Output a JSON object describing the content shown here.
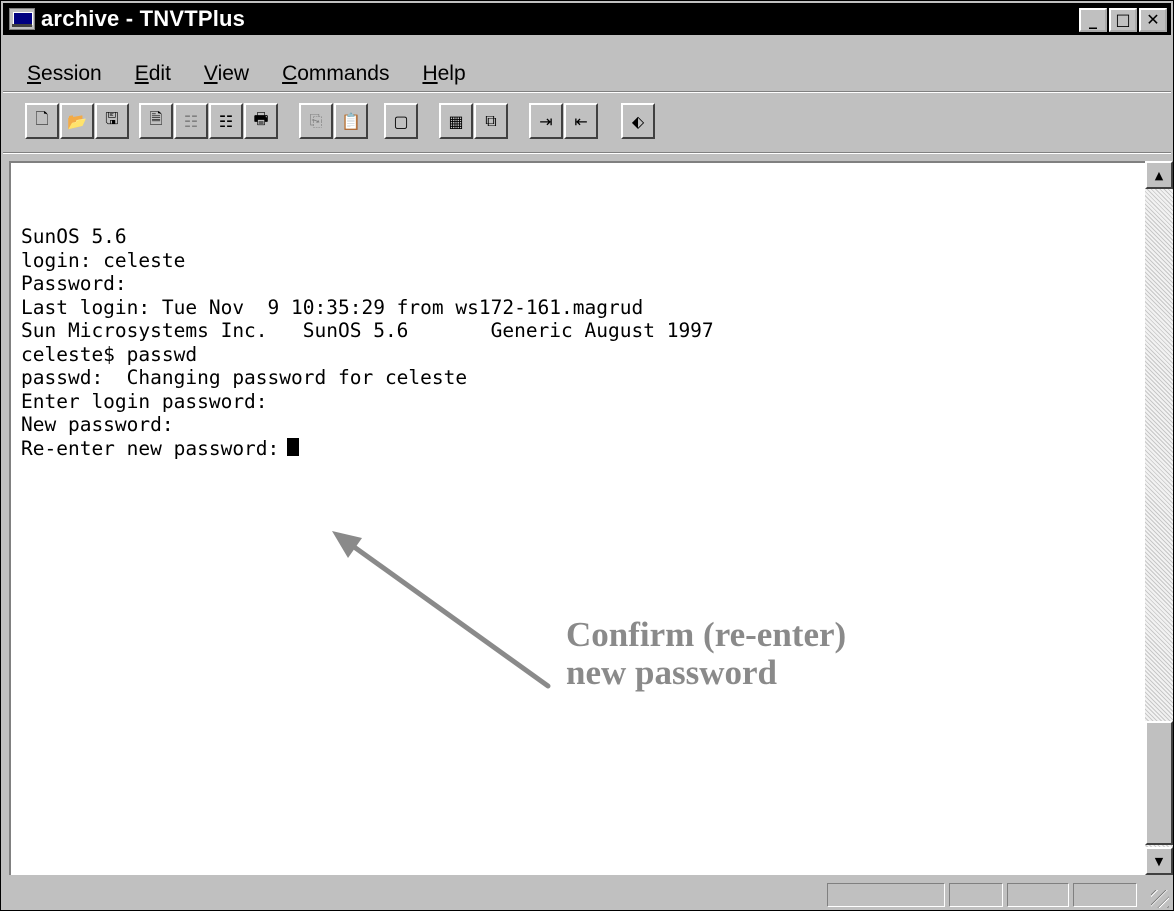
{
  "window": {
    "title": "archive - TNVTPlus",
    "controls": {
      "minimize": "_",
      "maximize": "□",
      "close": "✕"
    }
  },
  "menubar": {
    "items": [
      {
        "accel": "S",
        "rest": "ession"
      },
      {
        "accel": "E",
        "rest": "dit"
      },
      {
        "accel": "V",
        "rest": "iew"
      },
      {
        "accel": "C",
        "rest": "ommands"
      },
      {
        "accel": "H",
        "rest": "elp"
      }
    ]
  },
  "toolbar": {
    "buttons": [
      {
        "name": "new-document-icon",
        "glyph": "🗋",
        "dim": false
      },
      {
        "name": "open-folder-icon",
        "glyph": "📂",
        "dim": false
      },
      {
        "name": "save-disk-icon",
        "glyph": "🖫",
        "dim": false
      },
      {
        "name": "properties-icon",
        "glyph": "🗎",
        "dim": false
      },
      {
        "name": "tabs-icon",
        "glyph": "☷",
        "dim": true
      },
      {
        "name": "columns-icon",
        "glyph": "☷",
        "dim": false
      },
      {
        "name": "print-icon",
        "glyph": "🖶",
        "dim": false
      },
      {
        "name": "copy-icon",
        "glyph": "⎘",
        "dim": true
      },
      {
        "name": "paste-icon",
        "glyph": "📋",
        "dim": false
      },
      {
        "name": "display-icon",
        "glyph": "▢",
        "dim": false
      },
      {
        "name": "grid-icon",
        "glyph": "▦",
        "dim": false
      },
      {
        "name": "screen-copy-icon",
        "glyph": "⧉",
        "dim": false
      },
      {
        "name": "receive-file-icon",
        "glyph": "⇥",
        "dim": false
      },
      {
        "name": "send-file-icon",
        "glyph": "⇤",
        "dim": false
      },
      {
        "name": "help-book-icon",
        "glyph": "⬖",
        "dim": false
      }
    ]
  },
  "terminal": {
    "lines": [
      "SunOS 5.6",
      "",
      "login: celeste",
      "Password:",
      "Last login: Tue Nov  9 10:35:29 from ws172-161.magrud",
      "Sun Microsystems Inc.   SunOS 5.6       Generic August 1997",
      "celeste$ passwd",
      "passwd:  Changing password for celeste",
      "Enter login password:",
      "New password:"
    ],
    "prompt_line": "Re-enter new password:"
  },
  "scrollbar": {
    "up_glyph": "▲",
    "down_glyph": "▼"
  },
  "annotation": {
    "line1": "Confirm (re-enter)",
    "line2": "new password",
    "color": "#8a8a8a"
  }
}
